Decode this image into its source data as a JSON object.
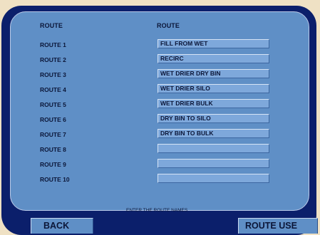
{
  "headers": {
    "left": "ROUTE",
    "right": "ROUTE"
  },
  "routes": [
    {
      "label": "ROUTE 1",
      "value": "FILL FROM WET"
    },
    {
      "label": "ROUTE 2",
      "value": "RECIRC"
    },
    {
      "label": "ROUTE 3",
      "value": "WET DRIER DRY BIN"
    },
    {
      "label": "ROUTE 4",
      "value": "WET DRIER SILO"
    },
    {
      "label": "ROUTE 5",
      "value": "WET DRIER BULK"
    },
    {
      "label": "ROUTE 6",
      "value": "DRY BIN TO SILO"
    },
    {
      "label": "ROUTE 7",
      "value": "DRY BIN TO BULK"
    },
    {
      "label": "ROUTE 8",
      "value": ""
    },
    {
      "label": "ROUTE 9",
      "value": ""
    },
    {
      "label": "ROUTE 10",
      "value": ""
    }
  ],
  "hint": "ENTER THE ROUTE NAMES",
  "buttons": {
    "back": "BACK",
    "route_use": "ROUTE USE"
  },
  "colors": {
    "background": "#efe1c4",
    "bezel": "#0b1f6b",
    "panel": "#5f8fc6",
    "field": "#7ea8db",
    "text": "#0b1638"
  }
}
